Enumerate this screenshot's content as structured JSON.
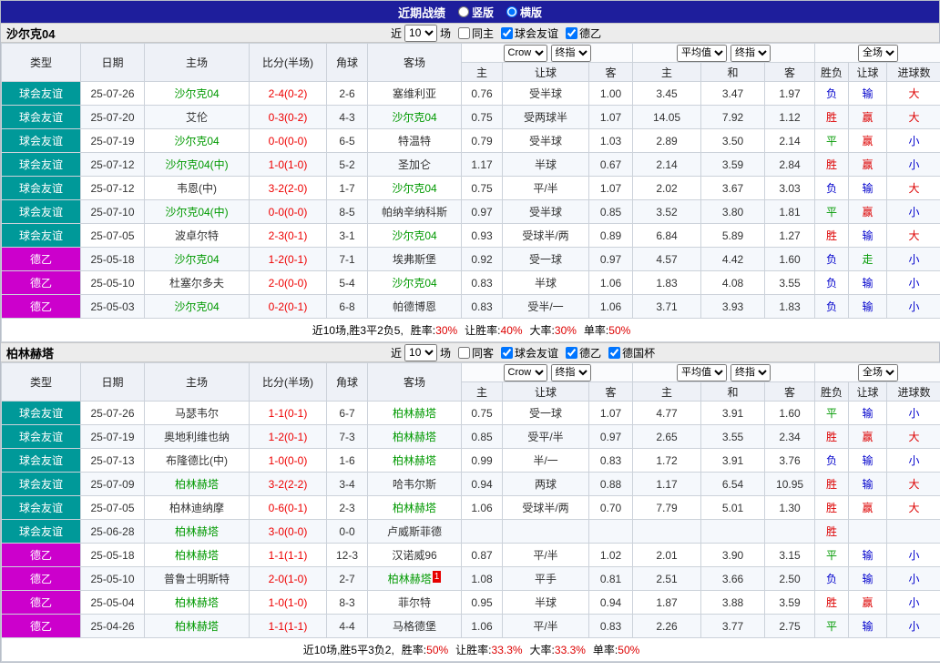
{
  "topbar": {
    "title": "近期战绩",
    "radios": [
      {
        "label": "竖版",
        "checked": false
      },
      {
        "label": "横版",
        "checked": true
      }
    ]
  },
  "colors": {
    "red": "#dd0000",
    "blue": "#0000cc",
    "green": "#009900",
    "focus_team": "#009900",
    "score": "#ee0000",
    "friendly_bg": "#009999",
    "d2_bg": "#cc00cc",
    "topbar_bg": "#1e1e9c"
  },
  "sections": [
    {
      "team": "沙尔克04",
      "controls": {
        "near_label": "近",
        "count": "10",
        "games_label": "场",
        "checkboxes": [
          {
            "label": "同主",
            "checked": false
          },
          {
            "label": "球会友谊",
            "checked": true
          },
          {
            "label": "德乙",
            "checked": true
          }
        ]
      },
      "header": {
        "left_cols": [
          "类型",
          "日期",
          "主场",
          "比分(半场)",
          "角球",
          "客场"
        ],
        "selects": {
          "bookmaker": "Crow",
          "bookmaker_index": "终指",
          "average": "平均值",
          "average_index": "终指",
          "scope": "全场"
        },
        "sub_cols": [
          "主",
          "让球",
          "客",
          "主",
          "和",
          "客",
          "胜负",
          "让球",
          "进球数"
        ]
      },
      "rows": [
        {
          "type": "球会友谊",
          "type_key": "friendly",
          "date": "25-07-26",
          "home": "沙尔克04",
          "home_focus": true,
          "home_badge": "",
          "score": "2-4(0-2)",
          "corner": "2-6",
          "away": "塞维利亚",
          "away_focus": false,
          "away_badge": "",
          "odds_home": "0.76",
          "handicap": "受半球",
          "odds_away": "1.00",
          "avg_home": "3.45",
          "avg_draw": "3.47",
          "avg_away": "1.97",
          "result": "负",
          "result_color": "blue",
          "handicap_result": "输",
          "handicap_color": "blue",
          "goals_result": "大",
          "goals_color": "red"
        },
        {
          "type": "球会友谊",
          "type_key": "friendly",
          "date": "25-07-20",
          "home": "艾伦",
          "home_focus": false,
          "home_badge": "",
          "score": "0-3(0-2)",
          "corner": "4-3",
          "away": "沙尔克04",
          "away_focus": true,
          "away_badge": "",
          "odds_home": "0.75",
          "handicap": "受两球半",
          "odds_away": "1.07",
          "avg_home": "14.05",
          "avg_draw": "7.92",
          "avg_away": "1.12",
          "result": "胜",
          "result_color": "red",
          "handicap_result": "赢",
          "handicap_color": "red",
          "goals_result": "大",
          "goals_color": "red"
        },
        {
          "type": "球会友谊",
          "type_key": "friendly",
          "date": "25-07-19",
          "home": "沙尔克04",
          "home_focus": true,
          "home_badge": "",
          "score": "0-0(0-0)",
          "corner": "6-5",
          "away": "特温特",
          "away_focus": false,
          "away_badge": "",
          "odds_home": "0.79",
          "handicap": "受半球",
          "odds_away": "1.03",
          "avg_home": "2.89",
          "avg_draw": "3.50",
          "avg_away": "2.14",
          "result": "平",
          "result_color": "green",
          "handicap_result": "赢",
          "handicap_color": "red",
          "goals_result": "小",
          "goals_color": "blue"
        },
        {
          "type": "球会友谊",
          "type_key": "friendly",
          "date": "25-07-12",
          "home": "沙尔克04(中)",
          "home_focus": true,
          "home_badge": "",
          "score": "1-0(1-0)",
          "corner": "5-2",
          "away": "圣加仑",
          "away_focus": false,
          "away_badge": "",
          "odds_home": "1.17",
          "handicap": "半球",
          "odds_away": "0.67",
          "avg_home": "2.14",
          "avg_draw": "3.59",
          "avg_away": "2.84",
          "result": "胜",
          "result_color": "red",
          "handicap_result": "赢",
          "handicap_color": "red",
          "goals_result": "小",
          "goals_color": "blue"
        },
        {
          "type": "球会友谊",
          "type_key": "friendly",
          "date": "25-07-12",
          "home": "韦恩(中)",
          "home_focus": false,
          "home_badge": "",
          "score": "3-2(2-0)",
          "corner": "1-7",
          "away": "沙尔克04",
          "away_focus": true,
          "away_badge": "",
          "odds_home": "0.75",
          "handicap": "平/半",
          "odds_away": "1.07",
          "avg_home": "2.02",
          "avg_draw": "3.67",
          "avg_away": "3.03",
          "result": "负",
          "result_color": "blue",
          "handicap_result": "输",
          "handicap_color": "blue",
          "goals_result": "大",
          "goals_color": "red"
        },
        {
          "type": "球会友谊",
          "type_key": "friendly",
          "date": "25-07-10",
          "home": "沙尔克04(中)",
          "home_focus": true,
          "home_badge": "",
          "score": "0-0(0-0)",
          "corner": "8-5",
          "away": "帕纳辛纳科斯",
          "away_focus": false,
          "away_badge": "",
          "odds_home": "0.97",
          "handicap": "受半球",
          "odds_away": "0.85",
          "avg_home": "3.52",
          "avg_draw": "3.80",
          "avg_away": "1.81",
          "result": "平",
          "result_color": "green",
          "handicap_result": "赢",
          "handicap_color": "red",
          "goals_result": "小",
          "goals_color": "blue"
        },
        {
          "type": "球会友谊",
          "type_key": "friendly",
          "date": "25-07-05",
          "home": "波卓尔特",
          "home_focus": false,
          "home_badge": "",
          "score": "2-3(0-1)",
          "corner": "3-1",
          "away": "沙尔克04",
          "away_focus": true,
          "away_badge": "",
          "odds_home": "0.93",
          "handicap": "受球半/两",
          "odds_away": "0.89",
          "avg_home": "6.84",
          "avg_draw": "5.89",
          "avg_away": "1.27",
          "result": "胜",
          "result_color": "red",
          "handicap_result": "输",
          "handicap_color": "blue",
          "goals_result": "大",
          "goals_color": "red"
        },
        {
          "type": "德乙",
          "type_key": "d2",
          "date": "25-05-18",
          "home": "沙尔克04",
          "home_focus": true,
          "home_badge": "",
          "score": "1-2(0-1)",
          "corner": "7-1",
          "away": "埃弗斯堡",
          "away_focus": false,
          "away_badge": "",
          "odds_home": "0.92",
          "handicap": "受一球",
          "odds_away": "0.97",
          "avg_home": "4.57",
          "avg_draw": "4.42",
          "avg_away": "1.60",
          "result": "负",
          "result_color": "blue",
          "handicap_result": "走",
          "handicap_color": "green",
          "goals_result": "小",
          "goals_color": "blue"
        },
        {
          "type": "德乙",
          "type_key": "d2",
          "date": "25-05-10",
          "home": "杜塞尔多夫",
          "home_focus": false,
          "home_badge": "",
          "score": "2-0(0-0)",
          "corner": "5-4",
          "away": "沙尔克04",
          "away_focus": true,
          "away_badge": "",
          "odds_home": "0.83",
          "handicap": "半球",
          "odds_away": "1.06",
          "avg_home": "1.83",
          "avg_draw": "4.08",
          "avg_away": "3.55",
          "result": "负",
          "result_color": "blue",
          "handicap_result": "输",
          "handicap_color": "blue",
          "goals_result": "小",
          "goals_color": "blue"
        },
        {
          "type": "德乙",
          "type_key": "d2",
          "date": "25-05-03",
          "home": "沙尔克04",
          "home_focus": true,
          "home_badge": "",
          "score": "0-2(0-1)",
          "corner": "6-8",
          "away": "帕德博恩",
          "away_focus": false,
          "away_badge": "",
          "odds_home": "0.83",
          "handicap": "受半/一",
          "odds_away": "1.06",
          "avg_home": "3.71",
          "avg_draw": "3.93",
          "avg_away": "1.83",
          "result": "负",
          "result_color": "blue",
          "handicap_result": "输",
          "handicap_color": "blue",
          "goals_result": "小",
          "goals_color": "blue"
        }
      ],
      "summary": {
        "prefix": "近10场,胜3平2负5,",
        "stats": [
          {
            "label": "胜率:",
            "value": "30%"
          },
          {
            "label": "让胜率:",
            "value": "40%"
          },
          {
            "label": "大率:",
            "value": "30%"
          },
          {
            "label": "单率:",
            "value": "50%"
          }
        ]
      }
    },
    {
      "team": "柏林赫塔",
      "controls": {
        "near_label": "近",
        "count": "10",
        "games_label": "场",
        "checkboxes": [
          {
            "label": "同客",
            "checked": false
          },
          {
            "label": "球会友谊",
            "checked": true
          },
          {
            "label": "德乙",
            "checked": true
          },
          {
            "label": "德国杯",
            "checked": true
          }
        ]
      },
      "header": {
        "left_cols": [
          "类型",
          "日期",
          "主场",
          "比分(半场)",
          "角球",
          "客场"
        ],
        "selects": {
          "bookmaker": "Crow",
          "bookmaker_index": "终指",
          "average": "平均值",
          "average_index": "终指",
          "scope": "全场"
        },
        "sub_cols": [
          "主",
          "让球",
          "客",
          "主",
          "和",
          "客",
          "胜负",
          "让球",
          "进球数"
        ]
      },
      "rows": [
        {
          "type": "球会友谊",
          "type_key": "friendly",
          "date": "25-07-26",
          "home": "马瑟韦尔",
          "home_focus": false,
          "home_badge": "",
          "score": "1-1(0-1)",
          "corner": "6-7",
          "away": "柏林赫塔",
          "away_focus": true,
          "away_badge": "",
          "odds_home": "0.75",
          "handicap": "受一球",
          "odds_away": "1.07",
          "avg_home": "4.77",
          "avg_draw": "3.91",
          "avg_away": "1.60",
          "result": "平",
          "result_color": "green",
          "handicap_result": "输",
          "handicap_color": "blue",
          "goals_result": "小",
          "goals_color": "blue"
        },
        {
          "type": "球会友谊",
          "type_key": "friendly",
          "date": "25-07-19",
          "home": "奥地利维也纳",
          "home_focus": false,
          "home_badge": "",
          "score": "1-2(0-1)",
          "corner": "7-3",
          "away": "柏林赫塔",
          "away_focus": true,
          "away_badge": "",
          "odds_home": "0.85",
          "handicap": "受平/半",
          "odds_away": "0.97",
          "avg_home": "2.65",
          "avg_draw": "3.55",
          "avg_away": "2.34",
          "result": "胜",
          "result_color": "red",
          "handicap_result": "赢",
          "handicap_color": "red",
          "goals_result": "大",
          "goals_color": "red"
        },
        {
          "type": "球会友谊",
          "type_key": "friendly",
          "date": "25-07-13",
          "home": "布隆德比(中)",
          "home_focus": false,
          "home_badge": "",
          "score": "1-0(0-0)",
          "corner": "1-6",
          "away": "柏林赫塔",
          "away_focus": true,
          "away_badge": "",
          "odds_home": "0.99",
          "handicap": "半/一",
          "odds_away": "0.83",
          "avg_home": "1.72",
          "avg_draw": "3.91",
          "avg_away": "3.76",
          "result": "负",
          "result_color": "blue",
          "handicap_result": "输",
          "handicap_color": "blue",
          "goals_result": "小",
          "goals_color": "blue"
        },
        {
          "type": "球会友谊",
          "type_key": "friendly",
          "date": "25-07-09",
          "home": "柏林赫塔",
          "home_focus": true,
          "home_badge": "",
          "score": "3-2(2-2)",
          "corner": "3-4",
          "away": "哈韦尔斯",
          "away_focus": false,
          "away_badge": "",
          "odds_home": "0.94",
          "handicap": "两球",
          "odds_away": "0.88",
          "avg_home": "1.17",
          "avg_draw": "6.54",
          "avg_away": "10.95",
          "result": "胜",
          "result_color": "red",
          "handicap_result": "输",
          "handicap_color": "blue",
          "goals_result": "大",
          "goals_color": "red"
        },
        {
          "type": "球会友谊",
          "type_key": "friendly",
          "date": "25-07-05",
          "home": "柏林迪纳摩",
          "home_focus": false,
          "home_badge": "",
          "score": "0-6(0-1)",
          "corner": "2-3",
          "away": "柏林赫塔",
          "away_focus": true,
          "away_badge": "",
          "odds_home": "1.06",
          "handicap": "受球半/两",
          "odds_away": "0.70",
          "avg_home": "7.79",
          "avg_draw": "5.01",
          "avg_away": "1.30",
          "result": "胜",
          "result_color": "red",
          "handicap_result": "赢",
          "handicap_color": "red",
          "goals_result": "大",
          "goals_color": "red"
        },
        {
          "type": "球会友谊",
          "type_key": "friendly",
          "date": "25-06-28",
          "home": "柏林赫塔",
          "home_focus": true,
          "home_badge": "",
          "score": "3-0(0-0)",
          "corner": "0-0",
          "away": "卢威斯菲德",
          "away_focus": false,
          "away_badge": "",
          "odds_home": "",
          "handicap": "",
          "odds_away": "",
          "avg_home": "",
          "avg_draw": "",
          "avg_away": "",
          "result": "胜",
          "result_color": "red",
          "handicap_result": "",
          "handicap_color": "",
          "goals_result": "",
          "goals_color": ""
        },
        {
          "type": "德乙",
          "type_key": "d2",
          "date": "25-05-18",
          "home": "柏林赫塔",
          "home_focus": true,
          "home_badge": "",
          "score": "1-1(1-1)",
          "corner": "12-3",
          "away": "汉诺威96",
          "away_focus": false,
          "away_badge": "",
          "odds_home": "0.87",
          "handicap": "平/半",
          "odds_away": "1.02",
          "avg_home": "2.01",
          "avg_draw": "3.90",
          "avg_away": "3.15",
          "result": "平",
          "result_color": "green",
          "handicap_result": "输",
          "handicap_color": "blue",
          "goals_result": "小",
          "goals_color": "blue"
        },
        {
          "type": "德乙",
          "type_key": "d2",
          "date": "25-05-10",
          "home": "普鲁士明斯特",
          "home_focus": false,
          "home_badge": "",
          "score": "2-0(1-0)",
          "corner": "2-7",
          "away": "柏林赫塔",
          "away_focus": true,
          "away_badge": "1",
          "odds_home": "1.08",
          "handicap": "平手",
          "odds_away": "0.81",
          "avg_home": "2.51",
          "avg_draw": "3.66",
          "avg_away": "2.50",
          "result": "负",
          "result_color": "blue",
          "handicap_result": "输",
          "handicap_color": "blue",
          "goals_result": "小",
          "goals_color": "blue"
        },
        {
          "type": "德乙",
          "type_key": "d2",
          "date": "25-05-04",
          "home": "柏林赫塔",
          "home_focus": true,
          "home_badge": "",
          "score": "1-0(1-0)",
          "corner": "8-3",
          "away": "菲尔特",
          "away_focus": false,
          "away_badge": "",
          "odds_home": "0.95",
          "handicap": "半球",
          "odds_away": "0.94",
          "avg_home": "1.87",
          "avg_draw": "3.88",
          "avg_away": "3.59",
          "result": "胜",
          "result_color": "red",
          "handicap_result": "赢",
          "handicap_color": "red",
          "goals_result": "小",
          "goals_color": "blue"
        },
        {
          "type": "德乙",
          "type_key": "d2",
          "date": "25-04-26",
          "home": "柏林赫塔",
          "home_focus": true,
          "home_badge": "",
          "score": "1-1(1-1)",
          "corner": "4-4",
          "away": "马格德堡",
          "away_focus": false,
          "away_badge": "",
          "odds_home": "1.06",
          "handicap": "平/半",
          "odds_away": "0.83",
          "avg_home": "2.26",
          "avg_draw": "3.77",
          "avg_away": "2.75",
          "result": "平",
          "result_color": "green",
          "handicap_result": "输",
          "handicap_color": "blue",
          "goals_result": "小",
          "goals_color": "blue"
        }
      ],
      "summary": {
        "prefix": "近10场,胜5平3负2,",
        "stats": [
          {
            "label": "胜率:",
            "value": "50%"
          },
          {
            "label": "让胜率:",
            "value": "33.3%"
          },
          {
            "label": "大率:",
            "value": "33.3%"
          },
          {
            "label": "单率:",
            "value": "50%"
          }
        ]
      }
    }
  ]
}
